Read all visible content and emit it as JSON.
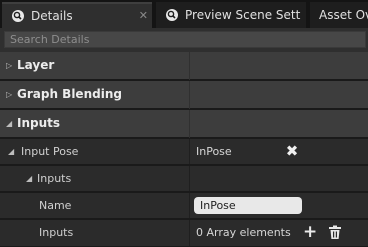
{
  "tabs": [
    {
      "label": "Details",
      "icon": "magnifier-icon",
      "active": true,
      "close": "✕"
    },
    {
      "label": "Preview Scene Sett",
      "icon": "magnifier-icon",
      "active": false
    },
    {
      "label": "Asset Ove",
      "icon": "",
      "active": false
    }
  ],
  "search": {
    "placeholder": "Search Details"
  },
  "categories": {
    "layer": "Layer",
    "graph_blending": "Graph Blending",
    "inputs": "Inputs"
  },
  "input_pose": {
    "label": "Input Pose",
    "value": "InPose",
    "clear_icon": "✖"
  },
  "inputs_group": {
    "label": "Inputs"
  },
  "name_row": {
    "label": "Name",
    "value": "InPose"
  },
  "inputs_row": {
    "label": "Inputs",
    "value": "0 Array elements",
    "add_icon": "+"
  },
  "colors": {
    "background": "#1a1a1a",
    "category": "#3d3d3d",
    "property": "#2b2b2b",
    "text": "#d8d8d8"
  }
}
